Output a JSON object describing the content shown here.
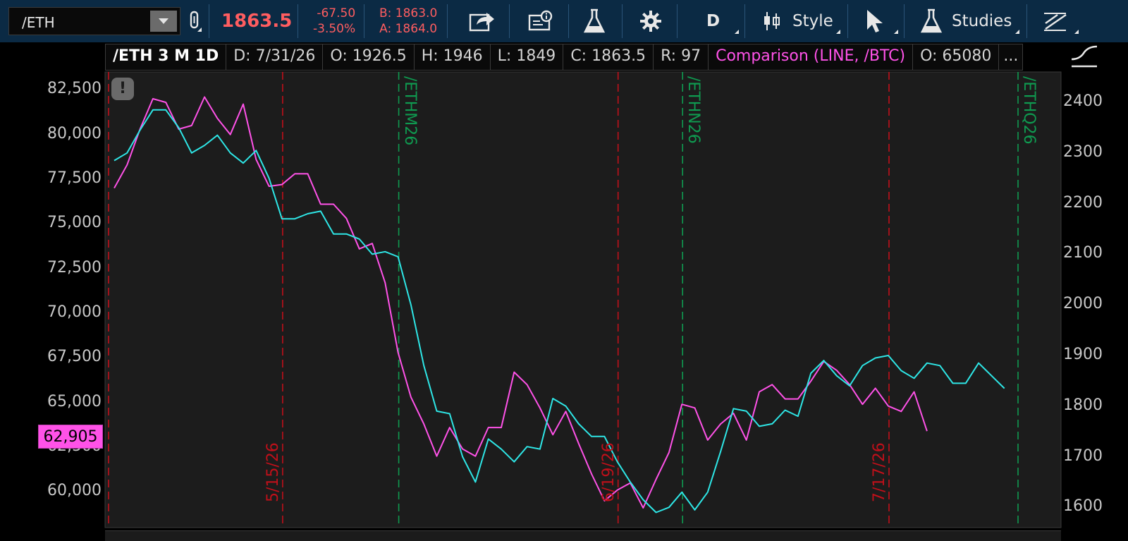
{
  "toolbar": {
    "symbol": "/ETH",
    "last_price": "1863.5",
    "net_change": "-67.50",
    "pct_change": "-3.50%",
    "bid": "B: 1863.0",
    "ask": "A: 1864.0",
    "aggregation": "D",
    "style_label": "Style",
    "studies_label": "Studies",
    "icons": [
      "link-icon",
      "share-icon",
      "news-icon",
      "flask-icon",
      "gear-icon",
      "candles-icon",
      "cursor-icon",
      "studies-flask-icon",
      "drawing-icon"
    ]
  },
  "header": {
    "title": "/ETH 3 M 1D",
    "date": "D: 7/31/26",
    "open": "O: 1926.5",
    "high": "H: 1946",
    "low": "L: 1849",
    "close": "C: 1863.5",
    "range": "R: 97",
    "comparison": "Comparison (LINE, /BTC)",
    "comp_open": "O: 65080",
    "more": "..."
  },
  "badge": {
    "warning": "!"
  },
  "price_tag": "62,905",
  "colors": {
    "eth_line": "#2ee6e6",
    "btc_line": "#ff52e8",
    "month_line": "#c0101a",
    "expiry_line": "#0f9a50",
    "down_red": "#ff5d60",
    "toolbar_bg": "#0b2a44"
  },
  "chart_data": {
    "type": "line",
    "left_axis": {
      "ticks": [
        "82,500",
        "80,000",
        "77,500",
        "75,000",
        "72,500",
        "70,000",
        "67,500",
        "65,000",
        "62,500",
        "60,000"
      ],
      "range": [
        58000,
        83500
      ]
    },
    "right_axis": {
      "ticks": [
        "2400",
        "2300",
        "2200",
        "2100",
        "2000",
        "1900",
        "1800",
        "1700",
        "1600"
      ],
      "range": [
        1560,
        2460
      ]
    },
    "series": [
      {
        "name": "/BTC",
        "axis": "left",
        "values": [
          77000,
          78300,
          80300,
          82000,
          81800,
          80300,
          80500,
          82100,
          80900,
          80000,
          81700,
          78600,
          77100,
          77200,
          77800,
          77800,
          76100,
          76100,
          75300,
          73600,
          73900,
          71700,
          67800,
          65300,
          63800,
          62000,
          63600,
          62400,
          62000,
          63600,
          63600,
          66700,
          66000,
          64700,
          63200,
          64500,
          62700,
          61000,
          59500,
          60100,
          60500,
          59100,
          60700,
          62200,
          64900,
          64700,
          62900,
          63800,
          64400,
          62900,
          65600,
          66000,
          65200,
          65200,
          66200,
          67300,
          66800,
          66000,
          64900,
          65800,
          64800,
          64500,
          65600,
          63400
        ]
      },
      {
        "name": "/ETH",
        "axis": "right",
        "values": [
          2285,
          2300,
          2345,
          2385,
          2385,
          2350,
          2300,
          2315,
          2335,
          2300,
          2280,
          2305,
          2250,
          2170,
          2170,
          2180,
          2185,
          2140,
          2140,
          2130,
          2100,
          2105,
          2095,
          2000,
          1880,
          1790,
          1785,
          1700,
          1650,
          1735,
          1715,
          1690,
          1720,
          1715,
          1815,
          1800,
          1765,
          1740,
          1740,
          1690,
          1650,
          1615,
          1590,
          1600,
          1630,
          1595,
          1630,
          1710,
          1795,
          1790,
          1760,
          1765,
          1792,
          1780,
          1865,
          1890,
          1860,
          1840,
          1880,
          1895,
          1900,
          1870,
          1855,
          1885,
          1880,
          1845,
          1845,
          1885,
          1860,
          1835
        ]
      }
    ],
    "vertical_markers": [
      {
        "label": "5/15/26",
        "kind": "month",
        "index": 13
      },
      {
        "label": "/ETHM26",
        "kind": "expiry",
        "index": 22
      },
      {
        "label": "6/19/26",
        "kind": "month",
        "index": 39
      },
      {
        "label": "/ETHN26",
        "kind": "expiry",
        "index": 44
      },
      {
        "label": "7/17/26",
        "kind": "month",
        "index": 60
      },
      {
        "label": "/ETHQ26",
        "kind": "expiry",
        "index": 70
      }
    ]
  }
}
